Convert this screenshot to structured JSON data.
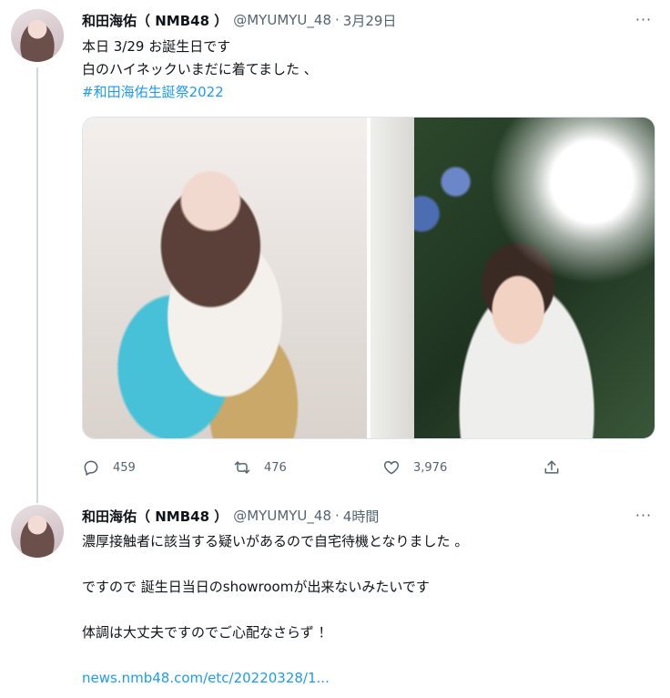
{
  "tweets": [
    {
      "name": "和田海佑（ NMB48 ）",
      "handle": "@MYUMYU_48",
      "separator": "·",
      "time": "3月29日",
      "lines": [
        "本日 3/29 お誕生日です",
        "白のハイネックいまだに着てました 、"
      ],
      "hashtag": "#和田海佑生誕祭2022",
      "stats": {
        "replies": "459",
        "retweets": "476",
        "likes": "3,976"
      }
    },
    {
      "name": "和田海佑（ NMB48 ）",
      "handle": "@MYUMYU_48",
      "separator": "·",
      "time": "4時間",
      "lines": [
        "濃厚接触者に該当する疑いがあるので自宅待機となりました 。",
        "ですので 誕生日当日のshowroomが出来ないみたいです",
        "体調は大丈夫ですのでご心配なさらず ！"
      ],
      "link": "news.nmb48.com/etc/20220328/1..."
    }
  ],
  "more_label": "···",
  "colors": {
    "accent": "#1d9bf0",
    "text": "#0f1419",
    "muted": "#536471",
    "thread": "#cfd9de"
  },
  "icons": [
    "reply-icon",
    "retweet-icon",
    "like-icon",
    "share-icon",
    "more-icon"
  ]
}
